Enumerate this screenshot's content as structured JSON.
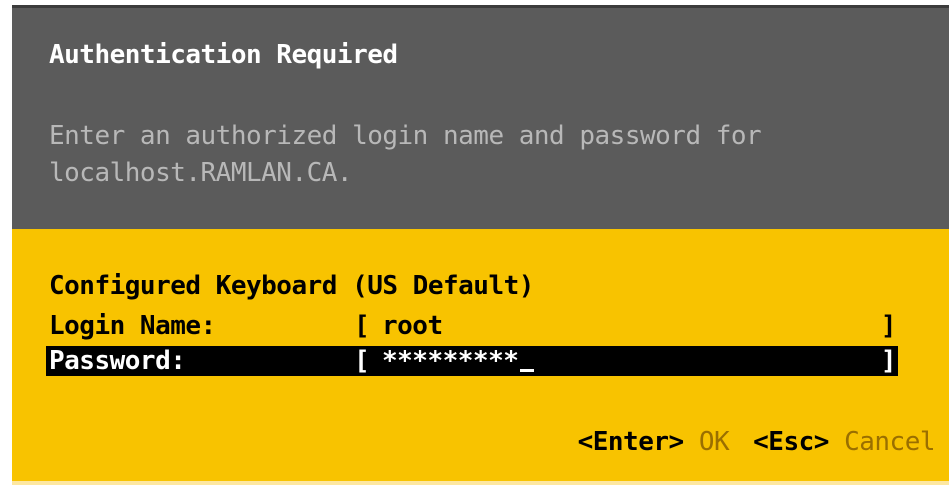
{
  "dialog": {
    "title": "Authentication Required",
    "message_line1": "Enter an authorized login name and password for",
    "message_line2": "localhost.RAMLAN.CA."
  },
  "form": {
    "keyboard_label": "Configured Keyboard (US Default)",
    "login": {
      "label": "Login Name:",
      "bracket_open": "[",
      "value": "root",
      "bracket_close": "]"
    },
    "password": {
      "label": "Password:",
      "bracket_open": "[",
      "value": "*********",
      "bracket_close": "]"
    }
  },
  "actions": {
    "ok_key": "<Enter>",
    "ok_label": "OK",
    "cancel_key": "<Esc>",
    "cancel_label": "Cancel"
  },
  "colors": {
    "header_bg": "#5b5b5b",
    "body_bg": "#f8c300",
    "selected_row_bg": "#000000",
    "action_label": "#9a6f00"
  }
}
